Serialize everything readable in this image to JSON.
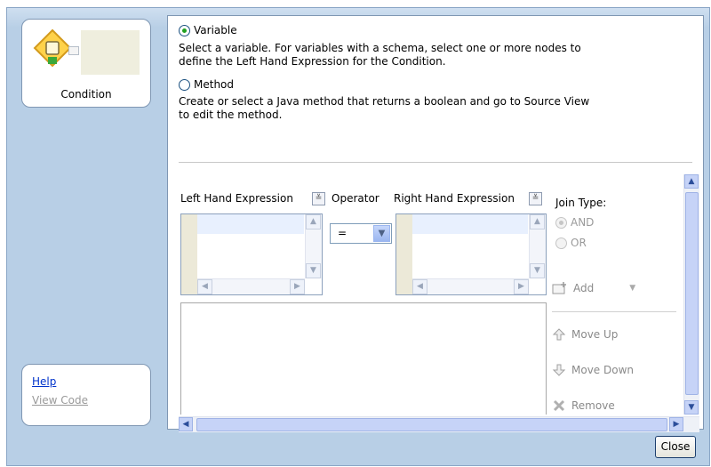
{
  "condition_card": {
    "label": "Condition"
  },
  "links": {
    "help": "Help",
    "view_code": "View Code"
  },
  "mode": {
    "variable_label": "Variable",
    "variable_desc": "Select a variable. For variables with a schema, select one or more nodes to define the Left Hand Expression for the Condition.",
    "method_label": "Method",
    "method_desc": "Create or select a Java method that returns a boolean and go to Source View to edit the method.",
    "selected": "Variable"
  },
  "expression": {
    "left_label": "Left Hand Expression",
    "operator_label": "Operator",
    "operator_value": "=",
    "right_label": "Right Hand Expression"
  },
  "join": {
    "label": "Join Type:",
    "and": "AND",
    "or": "OR",
    "selected": "AND"
  },
  "actions": {
    "add": "Add",
    "move_up": "Move Up",
    "move_down": "Move Down",
    "remove": "Remove"
  },
  "footer": {
    "close": "Close"
  }
}
